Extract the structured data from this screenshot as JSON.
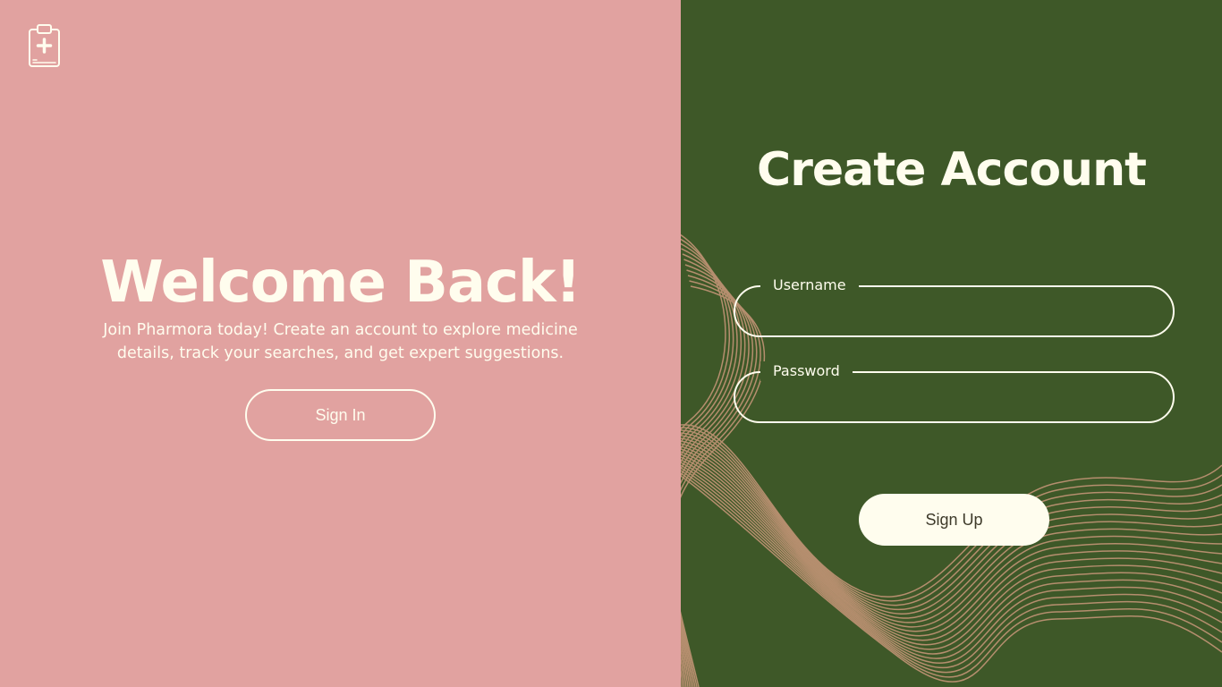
{
  "left": {
    "title": "Welcome Back!",
    "subtitle": "Join Pharmora today! Create an account to explore medicine details, track your searches, and get expert suggestions.",
    "signin_label": "Sign In"
  },
  "right": {
    "title": "Create Account",
    "username_label": "Username",
    "password_label": "Password",
    "signup_label": "Sign Up"
  },
  "icons": {
    "logo": "clipboard-medical-icon"
  },
  "colors": {
    "left_bg": "#E1A2A0",
    "right_bg": "#3E5828",
    "cream": "#FFFDEE",
    "wave": "#B58E6E"
  }
}
